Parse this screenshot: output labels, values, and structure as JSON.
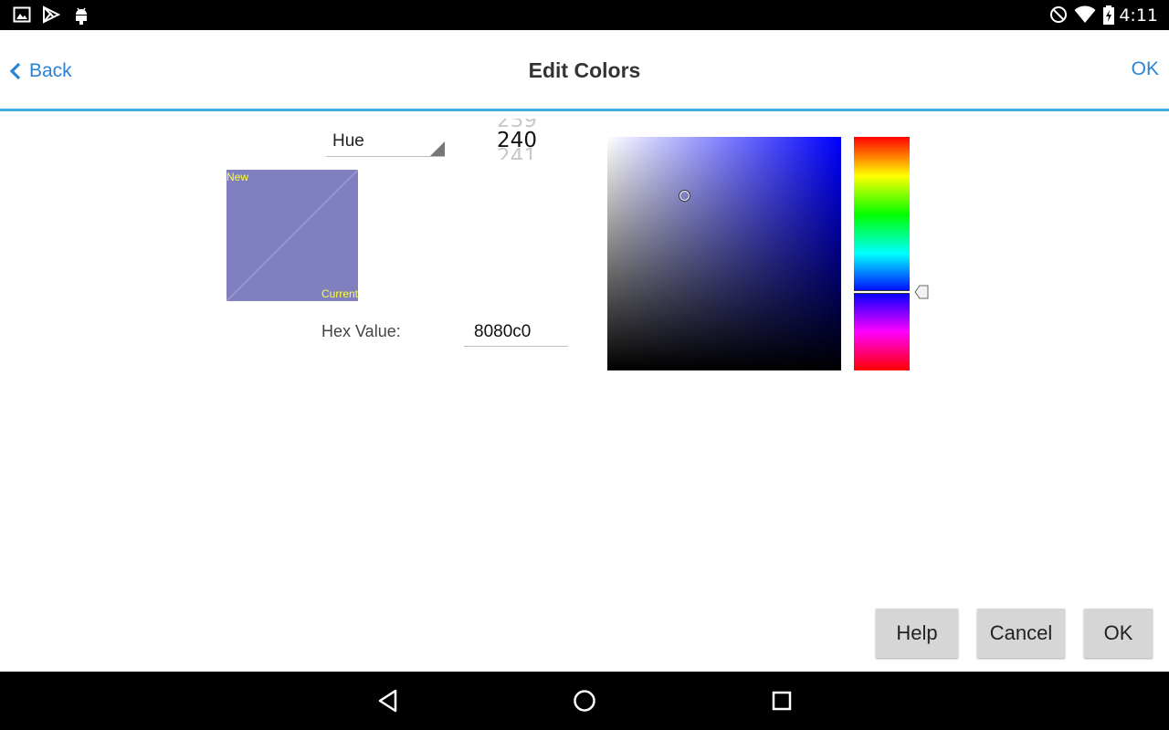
{
  "status_bar": {
    "time": "4:11"
  },
  "header": {
    "back_label": "Back",
    "title": "Edit Colors",
    "ok_label": "OK"
  },
  "mode_selector": {
    "selected": "Hue"
  },
  "number_picker": {
    "prev": "239",
    "current": "240",
    "next": "241"
  },
  "swatch": {
    "new_label": "New",
    "current_label": "Current",
    "color": "#8080c0"
  },
  "hex": {
    "label": "Hex Value:",
    "value": "8080c0"
  },
  "color_picker": {
    "hue": 240,
    "hue_color": "#0000ff"
  },
  "buttons": {
    "help": "Help",
    "cancel": "Cancel",
    "ok": "OK"
  },
  "colors": {
    "accent": "#2a83d6",
    "header_rule": "#3fa9e0",
    "button_bg": "#d6d6d6"
  }
}
